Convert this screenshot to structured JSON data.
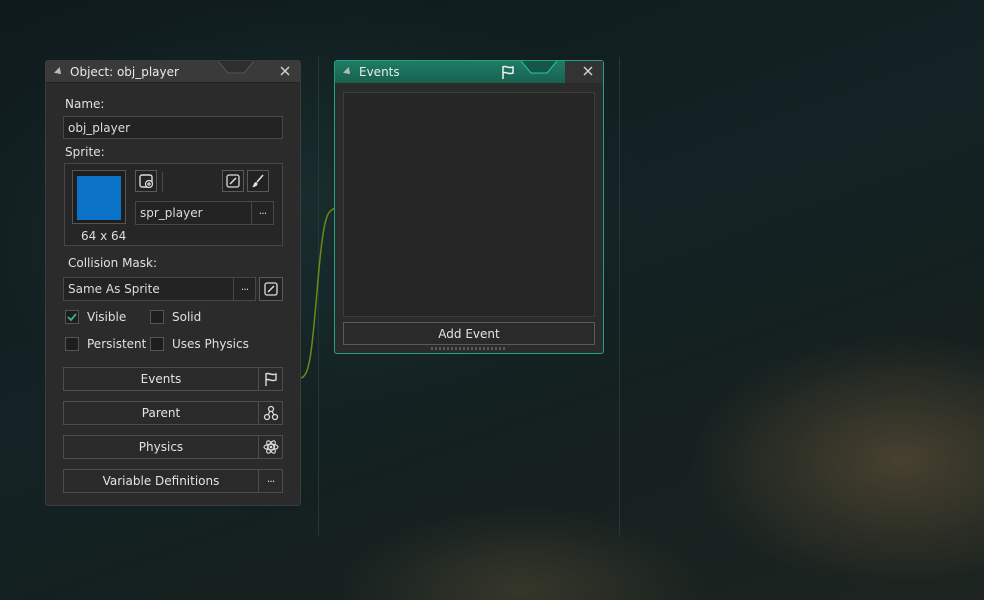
{
  "object_panel": {
    "title": "Object: obj_player",
    "name_label": "Name:",
    "name_value": "obj_player",
    "sprite_label": "Sprite:",
    "sprite_size": "64 x 64",
    "sprite_value": "spr_player",
    "sprite_color": "#0a73c8",
    "collision_label": "Collision Mask:",
    "collision_value": "Same As Sprite",
    "checkboxes": [
      {
        "label": "Visible",
        "checked": true
      },
      {
        "label": "Solid",
        "checked": false
      },
      {
        "label": "Persistent",
        "checked": false
      },
      {
        "label": "Uses Physics",
        "checked": false
      }
    ],
    "buttons": {
      "events": "Events",
      "parent": "Parent",
      "physics": "Physics",
      "variables": "Variable Definitions"
    },
    "more_glyph": "···"
  },
  "events_panel": {
    "title": "Events",
    "add_event": "Add Event",
    "accent_color": "#21a37f"
  }
}
